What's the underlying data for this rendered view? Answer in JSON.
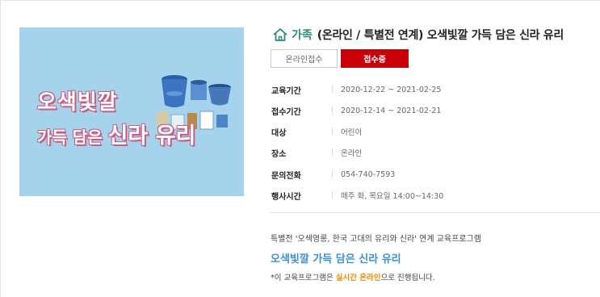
{
  "poster": {
    "line1": "오색빛깔",
    "line2_prefix": "가득 담은 ",
    "line2_big": "신라 유리",
    "bg_color": "#a6d3ec",
    "shadow_color": "#c95a82"
  },
  "header": {
    "category": "가족",
    "title": "(온라인 / 특별전 연계) 오색빛깔 가득 담은 신라 유리",
    "icon": "home-icon",
    "accent_color": "#2a8c7a"
  },
  "buttons": {
    "online_label": "온라인접수",
    "status_label": "접수중",
    "status_color": "#c8000a"
  },
  "info": [
    {
      "label": "교육기간",
      "value": "2020-12-22 ~ 2021-02-25"
    },
    {
      "label": "접수기간",
      "value": "2020-12-14 ~ 2021-02-21"
    },
    {
      "label": "대상",
      "value": "어린이"
    },
    {
      "label": "장소",
      "value": "온라인"
    },
    {
      "label": "문의전화",
      "value": "054-740-7593"
    },
    {
      "label": "행사시간",
      "value": "매주 화, 목요일 14:00~14:30"
    }
  ],
  "separator": "|",
  "description": {
    "line1": "특별전 '오색영롱, 한국 고대의 유리와 신라' 연계 교육프로그램",
    "line2": "오색빛깔 가득 담은 신라 유리",
    "line3_prefix": "*이 교육프로그램은 ",
    "line3_highlight": "실시간 온라인",
    "line3_suffix": "으로 진행됩니다.",
    "highlight_color": "#f08a00",
    "title_color": "#3b8fd6"
  }
}
